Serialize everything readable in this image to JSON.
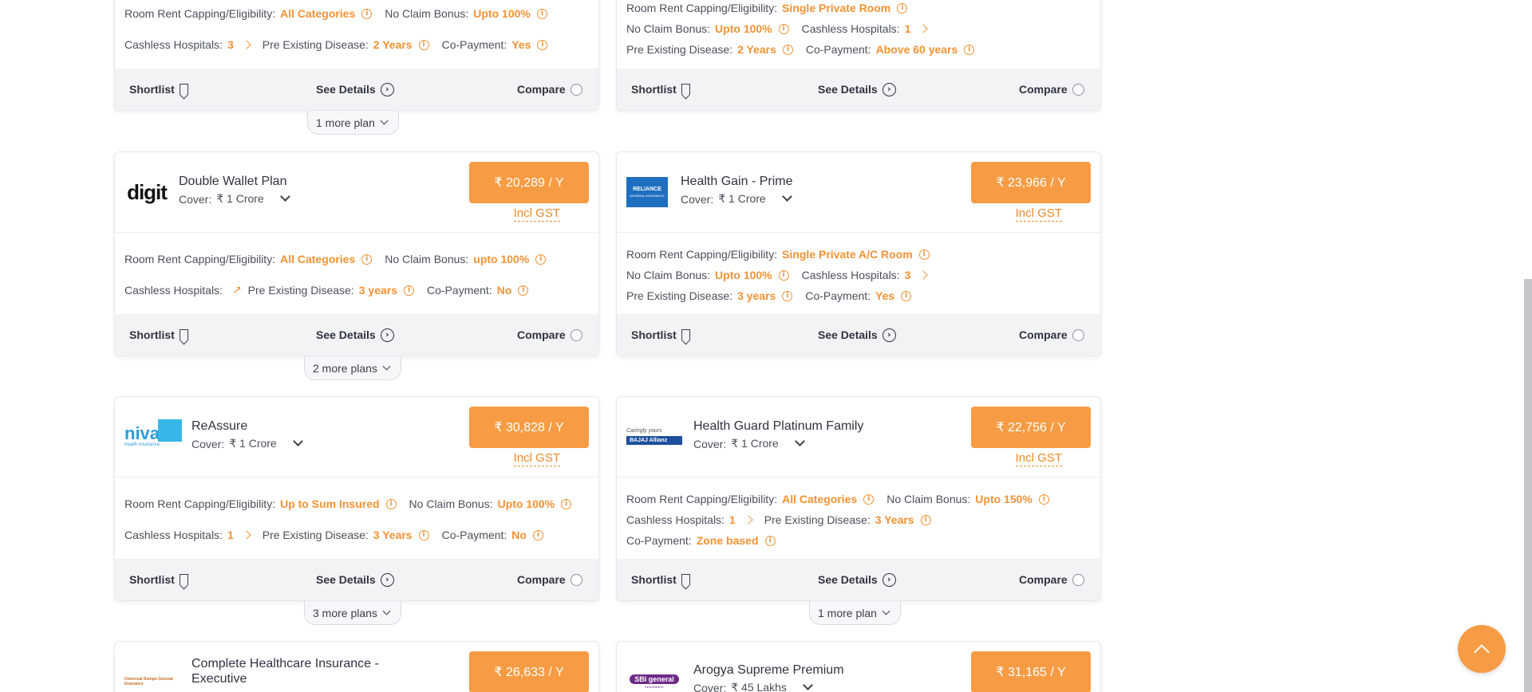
{
  "labels": {
    "room_rent": "Room Rent Capping/Eligibility:",
    "ncb": "No Claim Bonus:",
    "cashless": "Cashless Hospitals:",
    "ped": "Pre Existing Disease:",
    "copay": "Co-Payment:",
    "cover": "Cover:",
    "incl_gst": "Incl GST",
    "shortlist": "Shortlist",
    "see_details": "See Details",
    "compare": "Compare"
  },
  "cards": {
    "top_left": {
      "room_rent": "All Categories",
      "ncb": "Upto 100%",
      "cashless": "3",
      "ped": "2 Years",
      "copay": "Yes",
      "more": "1 more plan"
    },
    "top_right": {
      "room_rent": "Single Private Room",
      "ncb": "Upto 100%",
      "cashless": "1",
      "ped": "2 Years",
      "copay": "Above 60 years"
    },
    "digit": {
      "name": "Double Wallet Plan",
      "logo": "digit",
      "cover": "₹ 1 Crore",
      "price": "₹ 20,289 / Y",
      "room_rent": "All Categories",
      "ncb": "upto 100%",
      "ped": "3 years",
      "copay": "No",
      "more": "2 more plans"
    },
    "reliance": {
      "name": "Health Gain - Prime",
      "logo": "RELIANCE",
      "logo_sub": "GENERAL INSURANCE",
      "cover": "₹ 1 Crore",
      "price": "₹ 23,966 / Y",
      "room_rent": "Single Private A/C Room",
      "ncb": "Upto 100%",
      "cashless": "3",
      "ped": "3 years",
      "copay": "Yes"
    },
    "niva": {
      "name": "ReAssure",
      "logo": "niva",
      "logo_sub": "health insurance",
      "cover": "₹ 1 Crore",
      "price": "₹ 30,828 / Y",
      "room_rent": "Up to Sum Insured",
      "ncb": "Upto 100%",
      "cashless": "1",
      "ped": "3 Years",
      "copay": "No",
      "more": "3 more plans"
    },
    "bajaj": {
      "name": "Health Guard Platinum Family",
      "logo": "BAJAJ Allianz",
      "logo_sub": "Caringly yours",
      "cover": "₹ 1 Crore",
      "price": "₹ 22,756 / Y",
      "room_rent": "All Categories",
      "ncb": "Upto 150%",
      "cashless": "1",
      "ped": "3 Years",
      "copay": "Zone based",
      "more": "1 more plan"
    },
    "universal": {
      "name_line1": "Complete Healthcare Insurance -",
      "name_line2": "Executive",
      "logo": "Universal Sompo General Insurance",
      "price": "₹ 26,633 / Y"
    },
    "sbi": {
      "name": "Arogya Supreme Premium",
      "logo": "SBI general",
      "logo_sub": "INSURANCE",
      "cover": "₹ 45 Lakhs",
      "price": "₹ 31,165 / Y"
    }
  },
  "colors": {
    "accent": "#f79c44",
    "accent_text": "#f39233"
  }
}
